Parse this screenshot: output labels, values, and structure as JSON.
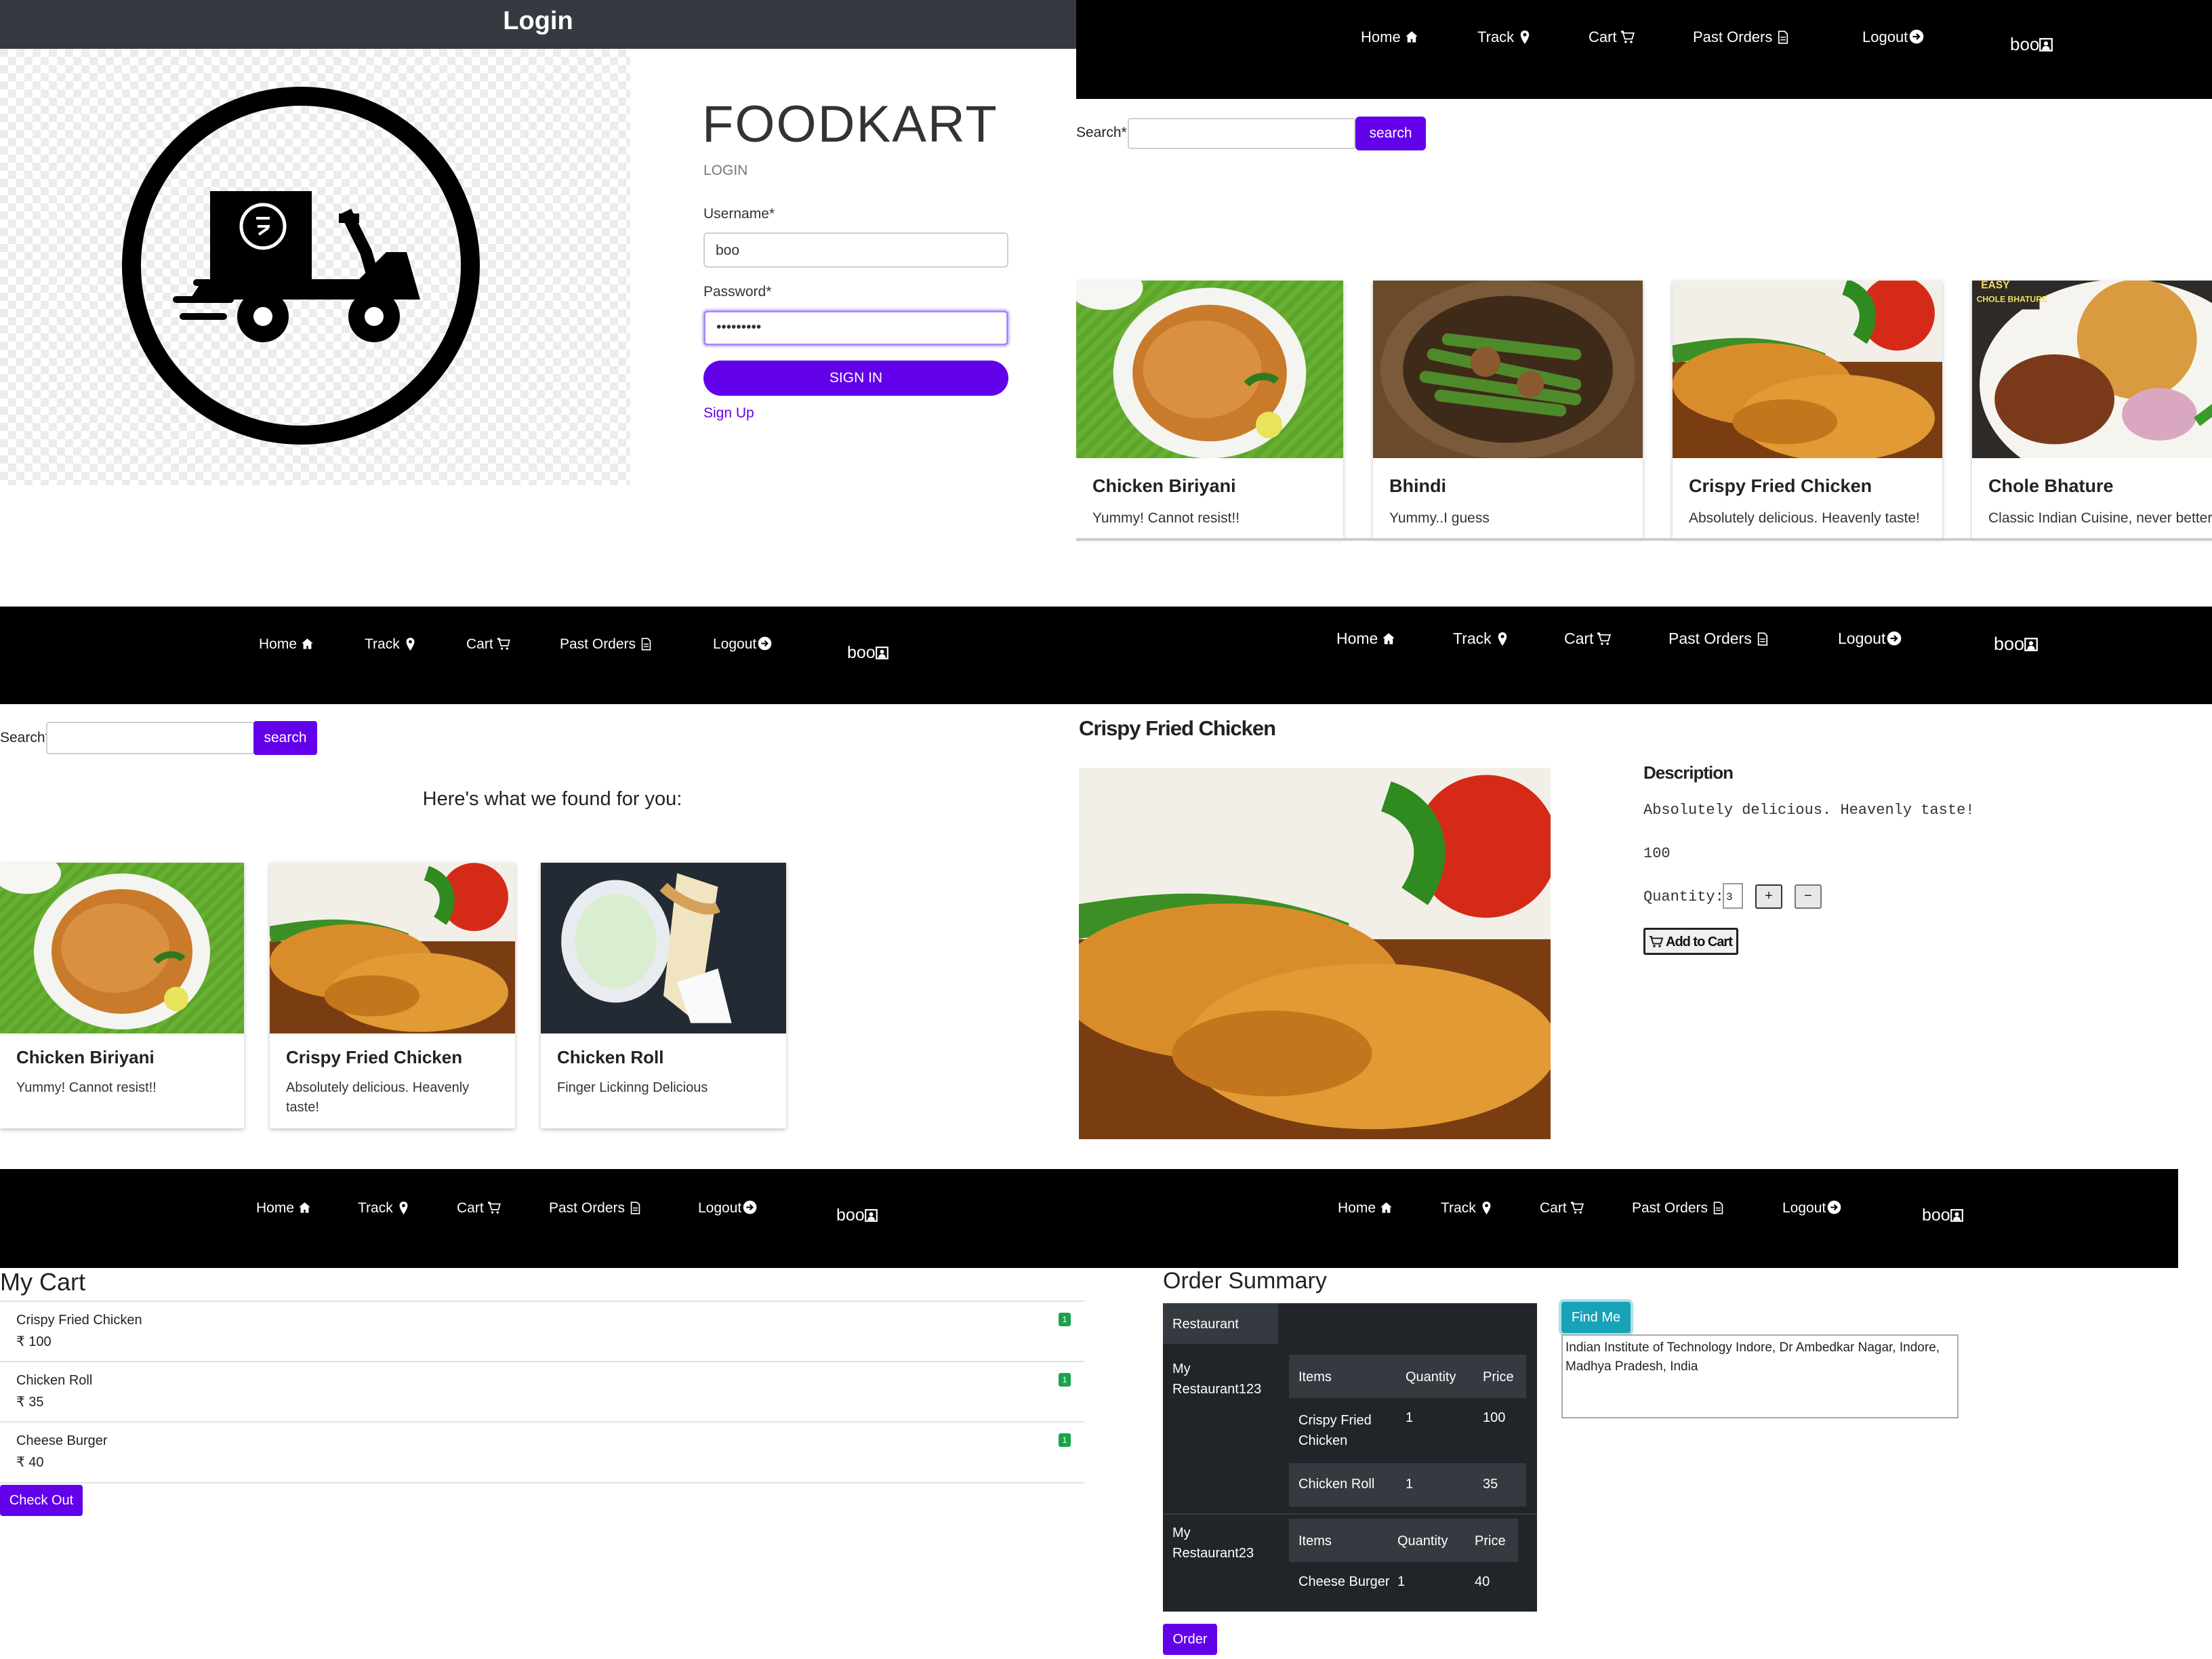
{
  "nav": {
    "home": "Home",
    "track": "Track",
    "cart": "Cart",
    "past_orders": "Past Orders",
    "logout": "Logout",
    "user": "boo"
  },
  "login": {
    "header": "Login",
    "brand": "FOODKART",
    "subtitle": "LOGIN",
    "username_label": "Username*",
    "username_value": "boo",
    "password_label": "Password*",
    "password_value": "•••••••••",
    "signin": "SIGN IN",
    "signup": "Sign Up"
  },
  "home": {
    "search_label": "Search*",
    "search_button": "search",
    "cards": [
      {
        "title": "Chicken Biriyani",
        "desc": "Yummy! Cannot resist!!"
      },
      {
        "title": "Bhindi",
        "desc": "Yummy..I guess"
      },
      {
        "title": "Crispy Fried Chicken",
        "desc": "Absolutely delicious. Heavenly taste!"
      },
      {
        "title": "Chole Bhature",
        "desc": "Classic Indian Cuisine, never better"
      }
    ]
  },
  "search_results": {
    "search_label": "Search*",
    "search_button": "search",
    "heading": "Here's what we found for you:",
    "cards": [
      {
        "title": "Chicken Biriyani",
        "desc": "Yummy! Cannot resist!!"
      },
      {
        "title": "Crispy Fried Chicken",
        "desc": "Absolutely delicious. Heavenly taste!"
      },
      {
        "title": "Chicken Roll",
        "desc": "Finger Lickinng Delicious"
      }
    ]
  },
  "detail": {
    "title": "Crispy Fried Chicken",
    "desc_heading": "Description",
    "desc": "Absolutely delicious. Heavenly taste!",
    "price": "100",
    "qty_label": "Quantity:",
    "qty_value": "3",
    "plus": "+",
    "minus": "−",
    "add_to_cart": "Add to Cart"
  },
  "cart": {
    "title": "My Cart",
    "items": [
      {
        "name": "Crispy Fried Chicken",
        "price": "₹ 100",
        "qty": "1"
      },
      {
        "name": "Chicken Roll",
        "price": "₹ 35",
        "qty": "1"
      },
      {
        "name": "Cheese Burger",
        "price": "₹ 40",
        "qty": "1"
      }
    ],
    "checkout": "Check Out"
  },
  "summary": {
    "title": "Order Summary",
    "restaurant_header": "Restaurant",
    "find_me": "Find Me",
    "address": "Indian Institute of Technology Indore, Dr Ambedkar Nagar, Indore, Madhya Pradesh, India",
    "col_items": "Items",
    "col_quantity": "Quantity",
    "col_price": "Price",
    "restaurants": [
      {
        "name": "My Restaurant123",
        "rows": [
          {
            "item": "Crispy Fried Chicken",
            "qty": "1",
            "price": "100"
          },
          {
            "item": "Chicken Roll",
            "qty": "1",
            "price": "35"
          }
        ]
      },
      {
        "name": "My Restaurant23",
        "rows": [
          {
            "item": "Cheese Burger",
            "qty": "1",
            "price": "40"
          }
        ]
      }
    ],
    "order": "Order"
  },
  "colors": {
    "accent": "#6200ea",
    "navbar": "#000000",
    "login_header": "#343a40",
    "dark_table": "#212529",
    "badge_green": "#1aa34a",
    "find_me": "#17a2b8"
  }
}
